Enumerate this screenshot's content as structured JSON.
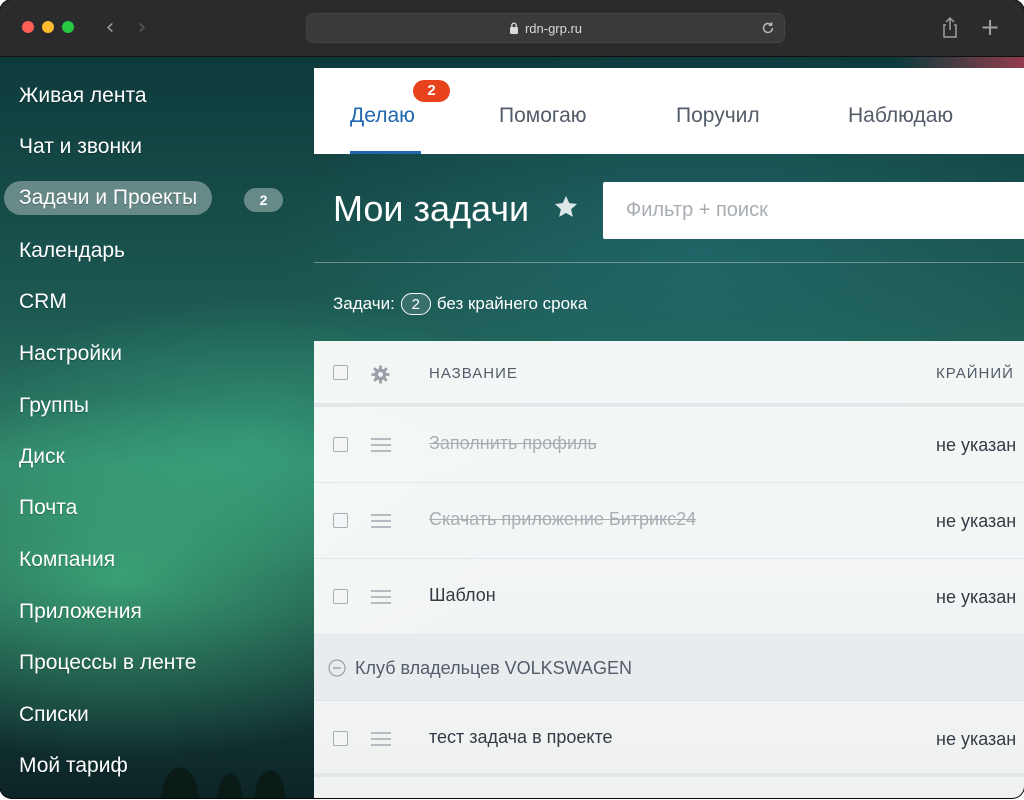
{
  "browser": {
    "url": "rdn-grp.ru",
    "traffic_lights": [
      "#ff5f57",
      "#febc2e",
      "#28c840"
    ]
  },
  "sidebar": {
    "items": [
      {
        "label": "Живая лента"
      },
      {
        "label": "Чат и звонки"
      },
      {
        "label": "Задачи и Проекты",
        "active": true,
        "counter": "2"
      },
      {
        "label": "Календарь"
      },
      {
        "label": "CRM"
      },
      {
        "label": "Настройки"
      },
      {
        "label": "Группы"
      },
      {
        "label": "Диск"
      },
      {
        "label": "Почта"
      },
      {
        "label": "Компания"
      },
      {
        "label": "Приложения"
      },
      {
        "label": "Процессы в ленте"
      },
      {
        "label": "Списки"
      },
      {
        "label": "Мой тариф"
      }
    ]
  },
  "tabs": [
    {
      "label": "Делаю",
      "active": true,
      "badge": "2"
    },
    {
      "label": "Помогаю"
    },
    {
      "label": "Поручил"
    },
    {
      "label": "Наблюдаю"
    }
  ],
  "page": {
    "title": "Мои задачи",
    "filter_placeholder": "Фильтр + поиск",
    "summary_prefix": "Задачи:",
    "summary_count": "2",
    "summary_suffix": "без крайнего срока"
  },
  "grid": {
    "columns": {
      "title": "НАЗВАНИЕ",
      "deadline": "КРАЙНИЙ"
    },
    "rows": [
      {
        "name": "Заполнить профиль",
        "deadline": "не указан",
        "done": true
      },
      {
        "name": "Скачать приложение Битрикс24",
        "deadline": "не указан",
        "done": true
      },
      {
        "name": "Шаблон",
        "deadline": "не указан",
        "done": false
      }
    ],
    "group": {
      "name": "Клуб владельцев VOLKSWAGEN",
      "rows": [
        {
          "name": "тест задача в проекте",
          "deadline": "не указан",
          "done": false
        }
      ]
    }
  },
  "colors": {
    "accent": "#2067b0",
    "badge": "#e9431e"
  }
}
